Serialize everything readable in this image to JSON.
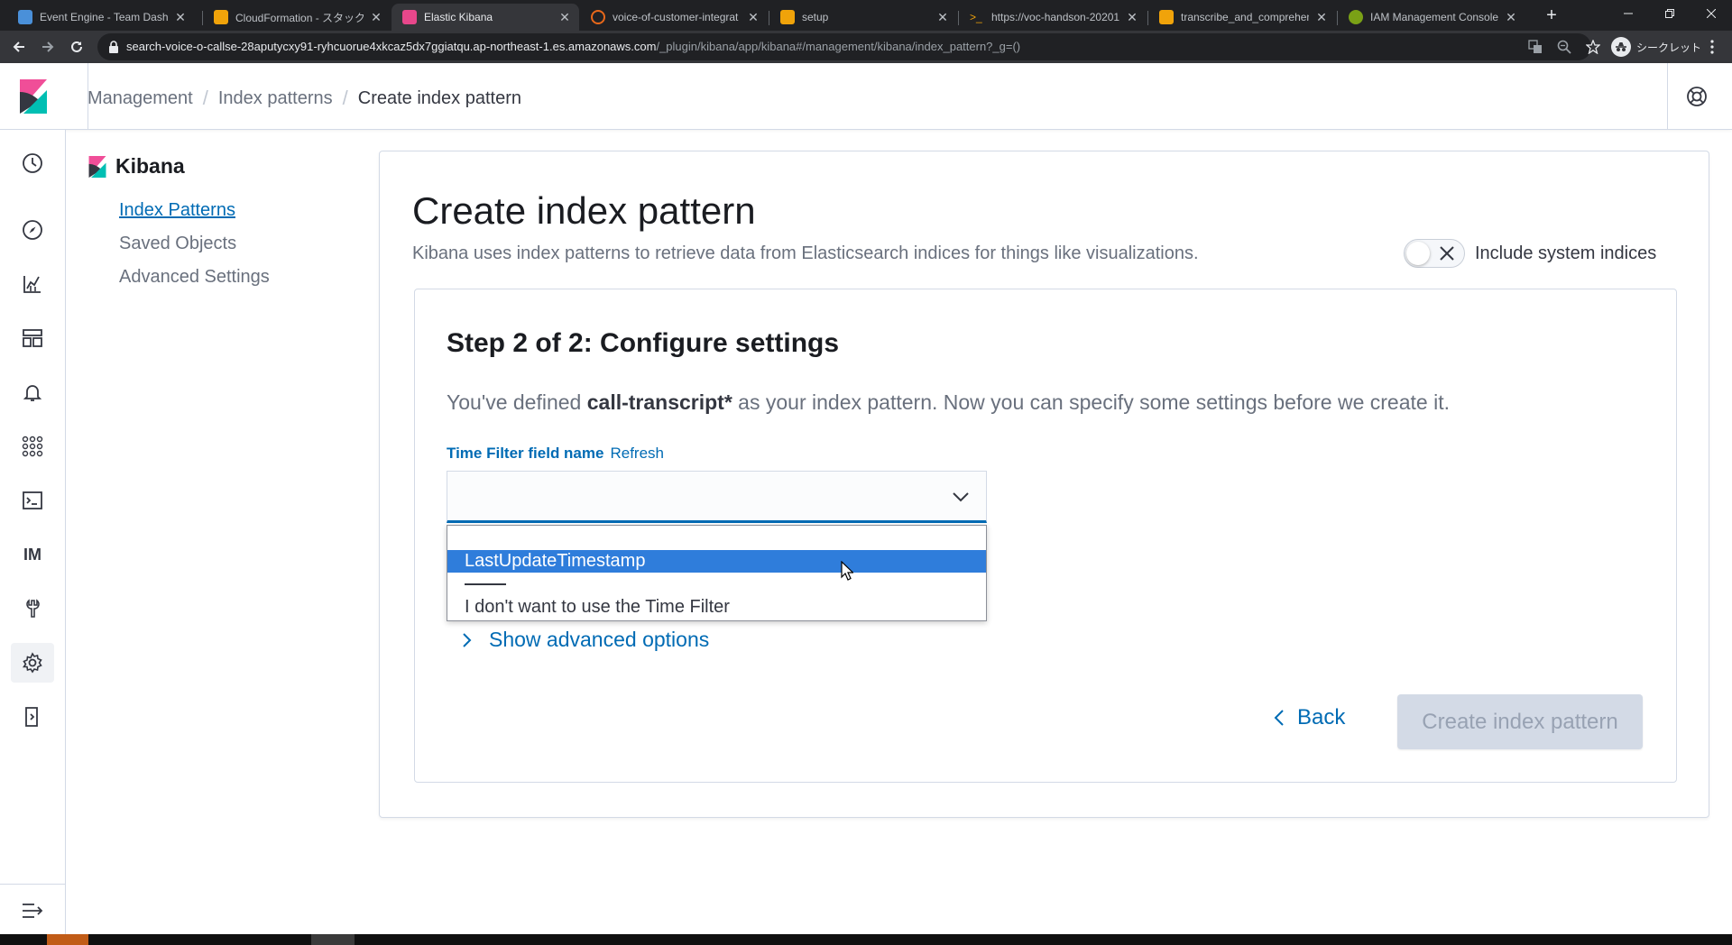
{
  "browser": {
    "tabs": [
      {
        "title": "Event Engine - Team Dashb",
        "favicon_color": "#4a90d9"
      },
      {
        "title": "CloudFormation - スタック vc",
        "favicon_color": "#f0a30a"
      },
      {
        "title": "Elastic Kibana",
        "favicon_color": "#e8478b"
      },
      {
        "title": "voice-of-customer-integrat",
        "favicon_color": "#e8681a"
      },
      {
        "title": "setup",
        "favicon_color": "#f0a30a"
      },
      {
        "title": "https://voc-handson-20201",
        "favicon_color": "#f0a30a"
      },
      {
        "title": "transcribe_and_comprehen",
        "favicon_color": "#f0a30a"
      },
      {
        "title": "IAM Management Console",
        "favicon_color": "#7aa116"
      }
    ],
    "url_host": "search-voice-o-callse-28aputycxy91-ryhcuorue4xkcaz5dx7ggiatqu.ap-northeast-1.es.amazonaws.com",
    "url_path": "/_plugin/kibana/app/kibana#/management/kibana/index_pattern?_g=()",
    "incognito_label": "シークレット"
  },
  "header": {
    "breadcrumbs": [
      "Management",
      "Index patterns",
      "Create index pattern"
    ]
  },
  "nav": {
    "dev_tools_abbrev": "IM"
  },
  "sidebar": {
    "title": "Kibana",
    "items": [
      {
        "label": "Index Patterns"
      },
      {
        "label": "Saved Objects"
      },
      {
        "label": "Advanced Settings"
      }
    ]
  },
  "main": {
    "title": "Create index pattern",
    "description": "Kibana uses index patterns to retrieve data from Elasticsearch indices for things like visualizations.",
    "system_indices_label": "Include system indices",
    "step_title": "Step 2 of 2: Configure settings",
    "step_text_before": "You've defined ",
    "index_pattern": "call-transcript*",
    "step_text_after": " as your index pattern. Now you can specify some settings before we create it.",
    "time_field_label": "Time Filter field name",
    "refresh_label": "Refresh",
    "dropdown_options": [
      "LastUpdateTimestamp",
      "I don't want to use the Time Filter"
    ],
    "advanced_label": "Show advanced options",
    "back_label": "Back",
    "create_label": "Create index pattern"
  },
  "colors": {
    "accent": "#006bb4",
    "selected_option": "#2f7ddb"
  }
}
